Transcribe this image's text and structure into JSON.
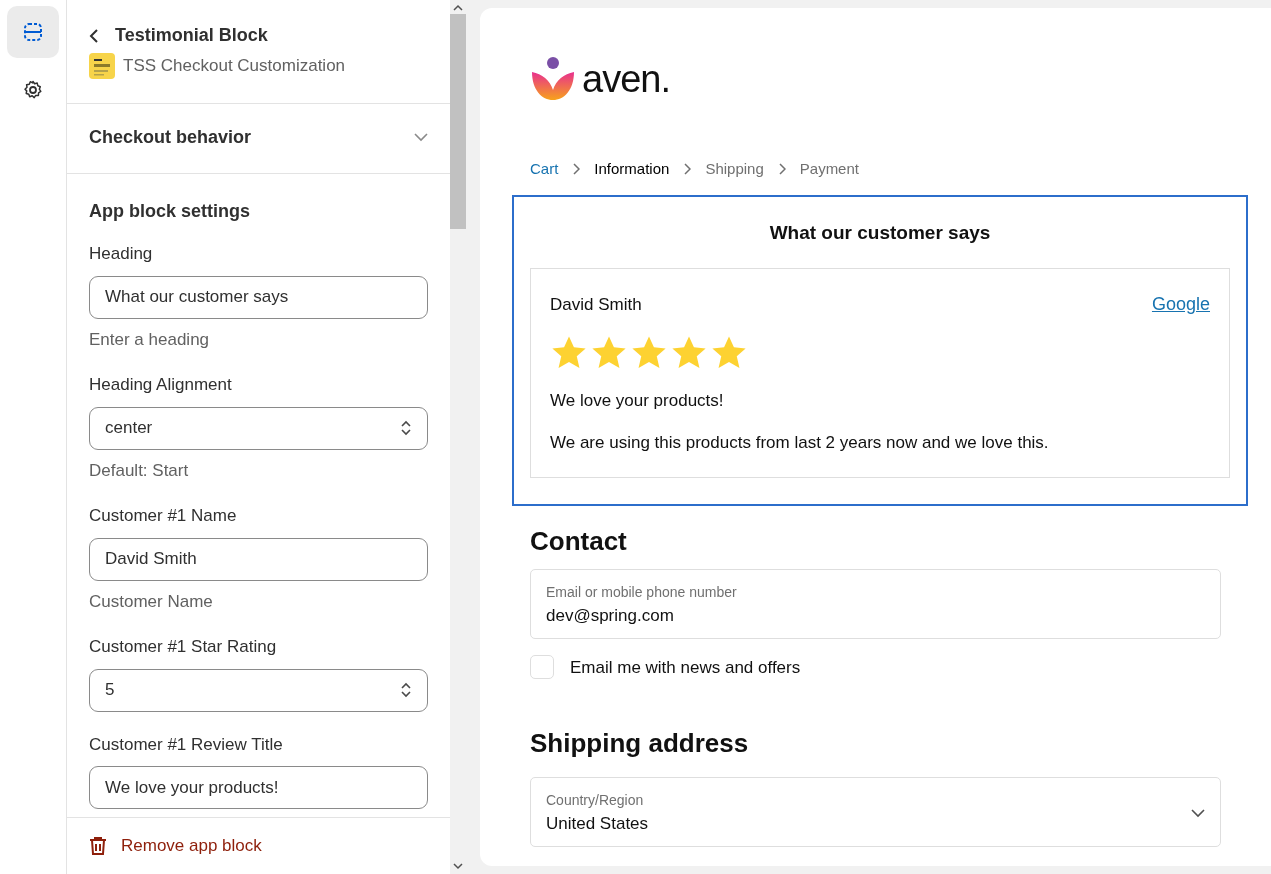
{
  "rail": {
    "items": [
      {
        "selected": true
      },
      {
        "selected": false
      }
    ]
  },
  "panel": {
    "title": "Testimonial Block",
    "app_name": "TSS Checkout Customization",
    "section": {
      "title": "Checkout behavior",
      "expanded": false
    },
    "settings_title": "App block settings",
    "fields": [
      {
        "kind": "text",
        "label": "Heading",
        "value": "What our customer says",
        "help": "Enter a heading"
      },
      {
        "kind": "select",
        "label": "Heading Alignment",
        "value": "center",
        "help": "Default: Start"
      },
      {
        "kind": "text",
        "label": "Customer #1 Name",
        "value": "David Smith",
        "help": "Customer Name"
      },
      {
        "kind": "select",
        "label": "Customer #1 Star Rating",
        "value": "5"
      },
      {
        "kind": "text",
        "label": "Customer #1 Review Title",
        "value": "We love your products!"
      }
    ],
    "remove_label": "Remove app block"
  },
  "preview": {
    "logo_text": "aven.",
    "breadcrumbs": [
      {
        "label": "Cart",
        "kind": "link"
      },
      {
        "label": "Information",
        "kind": "current"
      },
      {
        "label": "Shipping",
        "kind": "upcoming"
      },
      {
        "label": "Payment",
        "kind": "upcoming"
      }
    ],
    "testimonial": {
      "heading": "What our customer says",
      "name": "David Smith",
      "source": "Google",
      "stars": 5,
      "title": "We love your products!",
      "body": "We are using this products from last 2 years now and we love this."
    },
    "contact": {
      "title": "Contact",
      "email_label": "Email or mobile phone number",
      "email_value": "dev@spring.com",
      "newsletter_label": "Email me with news and offers",
      "newsletter_checked": false
    },
    "shipping": {
      "title": "Shipping address",
      "country_label": "Country/Region",
      "country_value": "United States"
    }
  }
}
